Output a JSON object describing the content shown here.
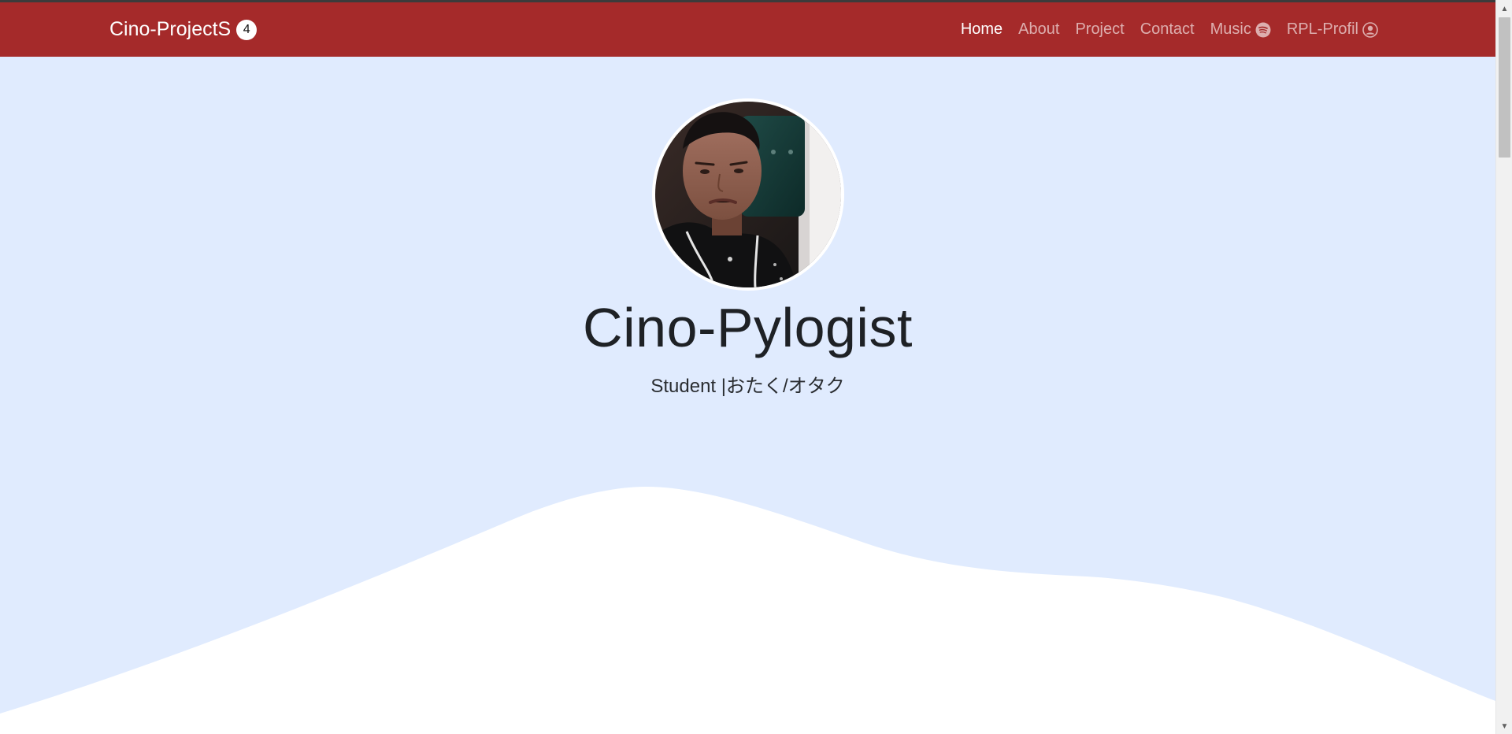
{
  "navbar": {
    "brand": "Cino-ProjectS",
    "badge": "4",
    "links": [
      {
        "label": "Home",
        "active": true
      },
      {
        "label": "About"
      },
      {
        "label": "Project"
      },
      {
        "label": "Contact"
      },
      {
        "label": "Music",
        "icon": "spotify-icon"
      },
      {
        "label": "RPL-Profil",
        "icon": "user-circle-icon"
      }
    ]
  },
  "hero": {
    "title": "Cino-Pylogist",
    "subtitle": "Student |おたく/オタク"
  },
  "colors": {
    "navbar": "#a52a2a",
    "background": "#e0ebfe",
    "wave": "#ffffff"
  }
}
